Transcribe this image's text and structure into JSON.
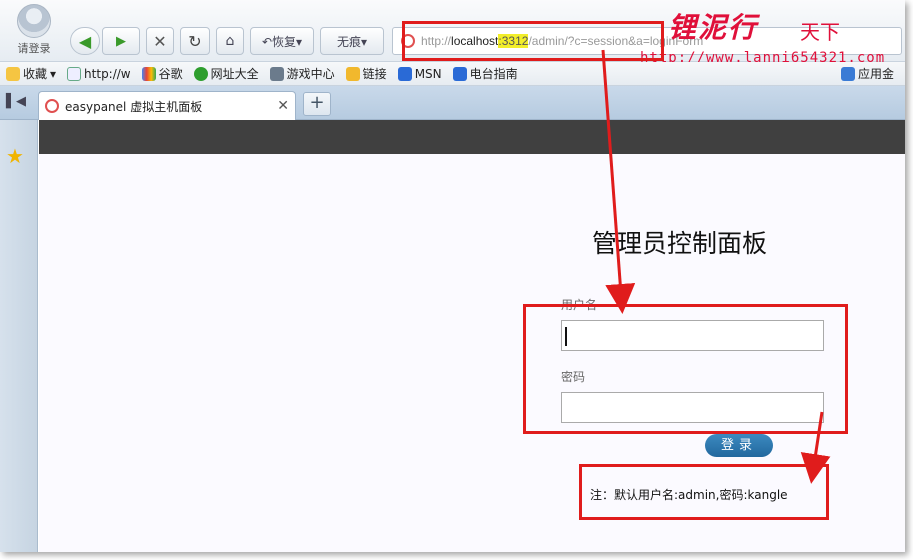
{
  "browser": {
    "avatar_label": "请登录",
    "buttons": {
      "back": "◀",
      "forward": "▶",
      "stop": "✕",
      "refresh": "↻",
      "home": "⌂",
      "restore": "↶恢复▾",
      "notrace": "无痕▾"
    },
    "url": {
      "scheme": "http://",
      "host": "localhost",
      "port": ":3312",
      "path": "/admin/?c=session&a=loginForm"
    },
    "bookmarks": [
      "收藏",
      "http://w",
      "谷歌",
      "网址大全",
      "游戏中心",
      "链接",
      "MSN",
      "电台指南",
      "应用金"
    ],
    "tab": {
      "title": "easypanel 虚拟主机面板",
      "close": "✕",
      "new": "+"
    }
  },
  "watermark": {
    "main": "锂泥行",
    "sub": "天下",
    "url": "http://www.lanni654321.com"
  },
  "login": {
    "title": "管理员控制面板",
    "username_label": "用户名",
    "username_value": "",
    "password_label": "密码",
    "password_value": "",
    "submit_label": "登录"
  },
  "note": "注：默认用户名:admin,密码:kangle",
  "colors": {
    "annotation": "#e01c1c",
    "button": "#2a72a8",
    "page_header": "#404040",
    "watermark": "#e0103a"
  }
}
